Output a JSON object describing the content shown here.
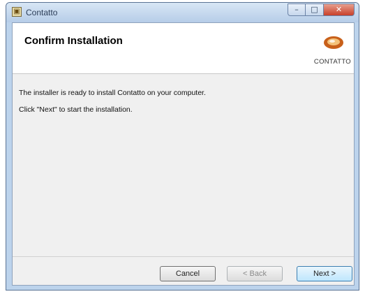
{
  "window": {
    "title": "Contatto",
    "controls": {
      "minimize": "–",
      "maximize": "□",
      "close": "✕"
    }
  },
  "header": {
    "title": "Confirm Installation",
    "logo_text": "CONTATTO"
  },
  "body": {
    "line1": "The installer is ready to install Contatto on your computer.",
    "line2": "Click \"Next\" to start the installation."
  },
  "buttons": {
    "cancel": "Cancel",
    "back": "< Back",
    "next": "Next >"
  },
  "colors": {
    "logo_accent": "#c8601a",
    "primary_button_border": "#3c7fb1"
  }
}
